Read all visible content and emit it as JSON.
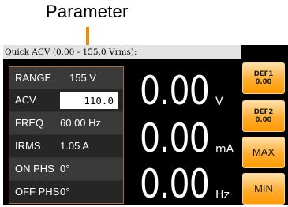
{
  "callout": {
    "label": "Parameter"
  },
  "status_bar": {
    "text": "Quick ACV (0.00 - 155.0 Vrms):"
  },
  "params": [
    {
      "name": "RANGE",
      "value": "155 V"
    },
    {
      "name": "ACV",
      "value": "110.0"
    },
    {
      "name": "FREQ",
      "value": "60.00 Hz"
    },
    {
      "name": "IRMS",
      "value": "1.05 A"
    },
    {
      "name": "ON PHS",
      "value": "0°"
    },
    {
      "name": "OFF PHS",
      "value": "0°"
    }
  ],
  "readouts": [
    {
      "value": "0.00",
      "unit": "V"
    },
    {
      "value": "0.00",
      "unit": "mA"
    },
    {
      "value": "0.00",
      "unit": "Hz"
    }
  ],
  "soft_keys": [
    {
      "line1": "DEF1",
      "line2": "0.00"
    },
    {
      "line1": "DEF2",
      "line2": "0.00"
    },
    {
      "label": "MAX"
    },
    {
      "label": "MIN"
    }
  ],
  "colors": {
    "accent": "#f28a00",
    "soft_key": "#ffa31a",
    "table_border": "#ad6a3c",
    "screen_bg": "#000000",
    "status_bar_bg": "#e3e3e3"
  }
}
